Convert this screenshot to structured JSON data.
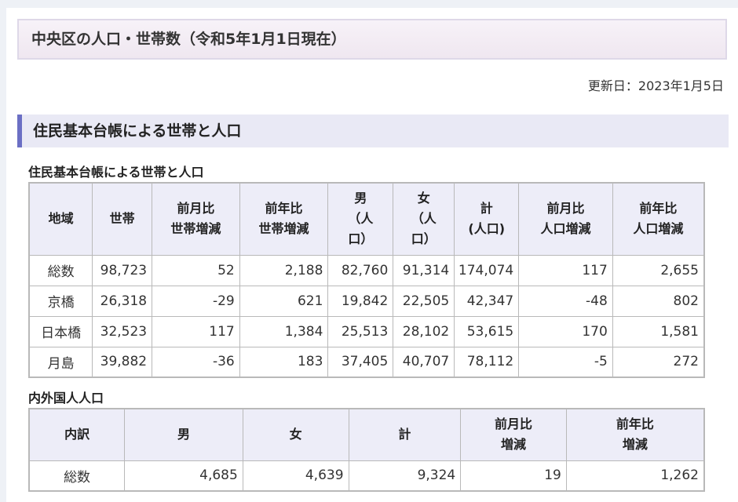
{
  "title": "中央区の人口・世帯数（令和5年1月1日現在）",
  "updated": "更新日：2023年1月5日",
  "section_heading": "住民基本台帳による世帯と人口",
  "table1": {
    "caption": "住民基本台帳による世帯と人口",
    "headers": [
      [
        "地域"
      ],
      [
        "世帯"
      ],
      [
        "前月比",
        "世帯増減"
      ],
      [
        "前年比",
        "世帯増減"
      ],
      [
        "男",
        "（人",
        "口）"
      ],
      [
        "女",
        "（人",
        "口）"
      ],
      [
        "計",
        "(人口)"
      ],
      [
        "前月比",
        "人口増減"
      ],
      [
        "前年比",
        "人口増減"
      ]
    ],
    "rows": [
      [
        "総数",
        "98,723",
        "52",
        "2,188",
        "82,760",
        "91,314",
        "174,074",
        "117",
        "2,655"
      ],
      [
        "京橋",
        "26,318",
        "-29",
        "621",
        "19,842",
        "22,505",
        "42,347",
        "-48",
        "802"
      ],
      [
        "日本橋",
        "32,523",
        "117",
        "1,384",
        "25,513",
        "28,102",
        "53,615",
        "170",
        "1,581"
      ],
      [
        "月島",
        "39,882",
        "-36",
        "183",
        "37,405",
        "40,707",
        "78,112",
        "-5",
        "272"
      ]
    ]
  },
  "table2": {
    "caption": "内外国人人口",
    "headers": [
      [
        "内訳"
      ],
      [
        "男"
      ],
      [
        "女"
      ],
      [
        "計"
      ],
      [
        "前月比",
        "増減"
      ],
      [
        "前年比",
        "増減"
      ]
    ],
    "rows": [
      [
        "総数",
        "4,685",
        "4,639",
        "9,324",
        "19",
        "1,262"
      ]
    ]
  }
}
